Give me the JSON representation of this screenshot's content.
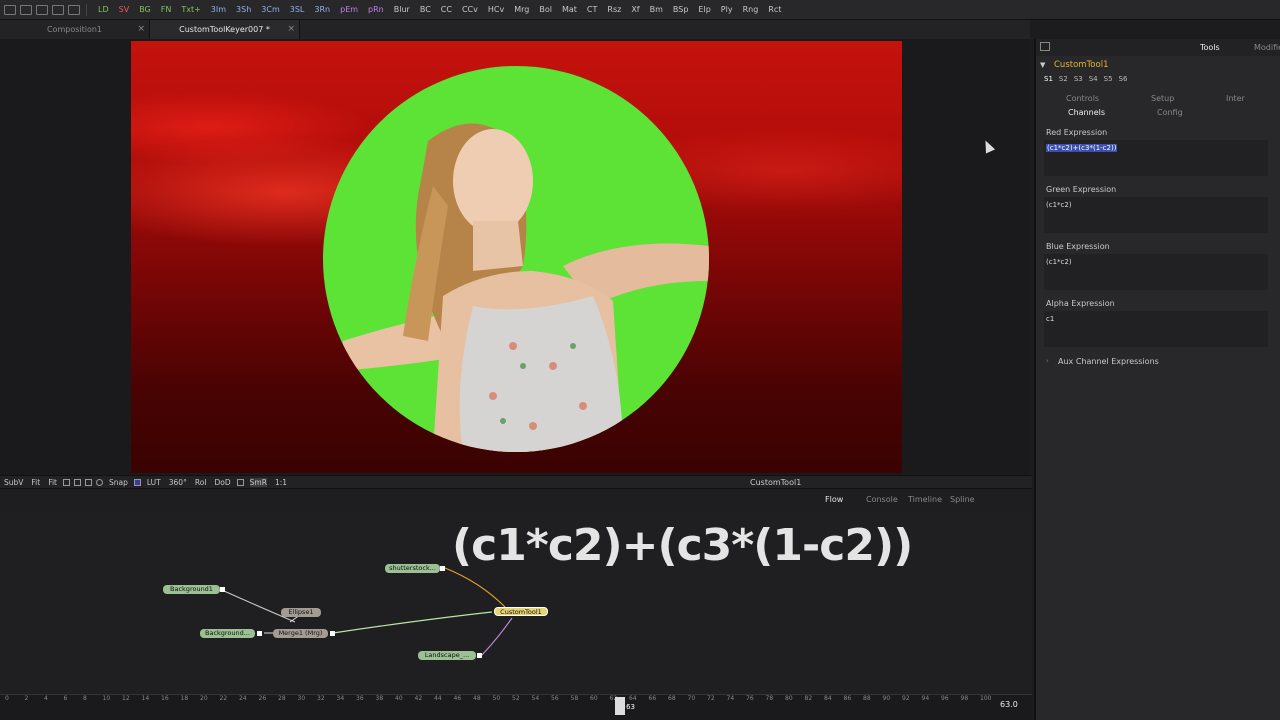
{
  "toolbar": {
    "tools": [
      {
        "label": "LD",
        "color": "#7dc55a"
      },
      {
        "label": "SV",
        "color": "#e65a5a"
      },
      {
        "label": "BG",
        "color": "#7dc55a"
      },
      {
        "label": "FN",
        "color": "#7dc55a"
      },
      {
        "label": "Txt+",
        "color": "#7dc55a"
      },
      {
        "label": "3Im",
        "color": "#8fb2e6"
      },
      {
        "label": "3Sh",
        "color": "#8fb2e6"
      },
      {
        "label": "3Cm",
        "color": "#8fb2e6"
      },
      {
        "label": "3SL",
        "color": "#8fb2e6"
      },
      {
        "label": "3Rn",
        "color": "#8fb2e6"
      },
      {
        "label": "pEm",
        "color": "#c27ee6"
      },
      {
        "label": "pRn",
        "color": "#c27ee6"
      },
      {
        "label": "Blur",
        "color": "#c8c8c8"
      },
      {
        "label": "BC",
        "color": "#c8c8c8"
      },
      {
        "label": "CC",
        "color": "#c8c8c8"
      },
      {
        "label": "CCv",
        "color": "#c8c8c8"
      },
      {
        "label": "HCv",
        "color": "#c8c8c8"
      },
      {
        "label": "Mrg",
        "color": "#c8c8c8"
      },
      {
        "label": "Bol",
        "color": "#c8c8c8"
      },
      {
        "label": "Mat",
        "color": "#c8c8c8"
      },
      {
        "label": "CT",
        "color": "#c8c8c8"
      },
      {
        "label": "Rsz",
        "color": "#c8c8c8"
      },
      {
        "label": "Xf",
        "color": "#c8c8c8"
      },
      {
        "label": "Bm",
        "color": "#c8c8c8"
      },
      {
        "label": "BSp",
        "color": "#c8c8c8"
      },
      {
        "label": "Elp",
        "color": "#c8c8c8"
      },
      {
        "label": "Ply",
        "color": "#c8c8c8"
      },
      {
        "label": "Rng",
        "color": "#c8c8c8"
      },
      {
        "label": "Rct",
        "color": "#c8c8c8"
      }
    ]
  },
  "tabs": [
    {
      "label": "Composition1",
      "close": "×"
    },
    {
      "label": "CustomToolKeyer007 *",
      "close": "×"
    }
  ],
  "viewer_toolbar": {
    "subv": "SubV",
    "fit1": "Fit",
    "fit2": "Fit",
    "snap": "Snap",
    "lut": "LUT",
    "deg": "360°",
    "roi": "RoI",
    "dod": "DoD",
    "smr": "SmR",
    "ratio": "1:1",
    "name": "CustomTool1"
  },
  "flow_tabs": {
    "flow": "Flow",
    "console": "Console",
    "timeline": "Timeline",
    "spline": "Spline"
  },
  "flow_overlay_text": "(c1*c2)+(c3*(1-c2))",
  "nodes": {
    "shutterstock": "shutterstock...",
    "background1": "Background1",
    "background2": "Background...",
    "ellipse": "Ellipse1",
    "merge": "Merge1 (Mrg)",
    "custom": "CustomTool1",
    "landscape": "Landscape_..."
  },
  "timeline": {
    "ticks": [
      "0",
      "2",
      "4",
      "6",
      "8",
      "10",
      "12",
      "14",
      "16",
      "18",
      "20",
      "22",
      "24",
      "26",
      "28",
      "30",
      "32",
      "34",
      "36",
      "38",
      "40",
      "42",
      "44",
      "46",
      "48",
      "50",
      "52",
      "54",
      "56",
      "58",
      "60",
      "62",
      "64",
      "66",
      "68",
      "70",
      "72",
      "74",
      "76",
      "78",
      "80",
      "82",
      "84",
      "86",
      "88",
      "90",
      "92",
      "94",
      "96",
      "98",
      "100"
    ],
    "current": "63",
    "value": "63.0"
  },
  "inspector": {
    "tools_tab": "Tools",
    "modifiers_tab": "Modifiers",
    "tool_name": "CustomTool1",
    "slots": [
      "S1",
      "S2",
      "S3",
      "S4",
      "S5",
      "S6"
    ],
    "tabs_row1": [
      "Controls",
      "Setup",
      "Inter"
    ],
    "tabs_row2": [
      "Channels",
      "Config"
    ],
    "red_label": "Red Expression",
    "red_value": "(c1*c2)+(c3*(1-c2))",
    "green_label": "Green Expression",
    "green_value": "(c1*c2)",
    "blue_label": "Blue Expression",
    "blue_value": "(c1*c2)",
    "alpha_label": "Alpha Expression",
    "alpha_value": "c1",
    "aux_label": "Aux Channel Expressions"
  }
}
